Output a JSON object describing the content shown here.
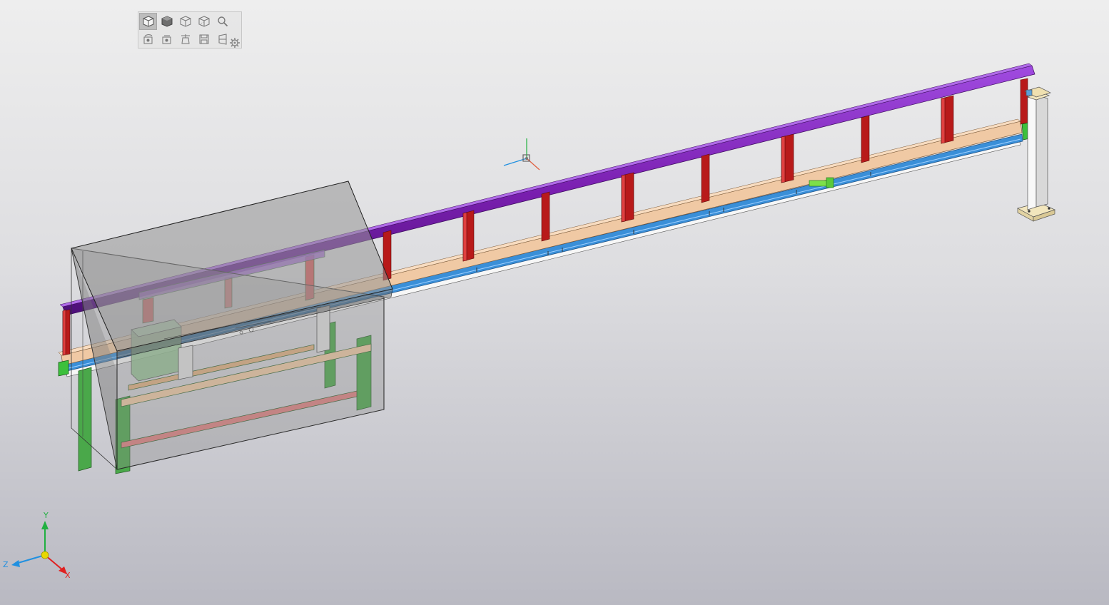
{
  "toolbar": {
    "row1": [
      "view-orientation-icon",
      "shaded-icon",
      "wireframe-icon",
      "hidden-lines-icon",
      "zoom-icon"
    ],
    "row2": [
      "rotate-view-icon",
      "pan-view-icon",
      "section-icon",
      "save-view-icon",
      "perspective-icon"
    ],
    "active": "view-orientation-icon",
    "settings_icon": "gear-icon"
  },
  "axis_triad": {
    "x": "X",
    "y": "Y",
    "z": "Z",
    "colors": {
      "x": "#e02020",
      "y": "#20b040",
      "z": "#2090e0",
      "origin": "#e8d800"
    }
  },
  "model_colors": {
    "top_rail": "#7a1fb0",
    "posts": "#b81a1a",
    "beam": "#f0c9a4",
    "guide_rail": "#3a8fd8",
    "frame": "#4aa84a",
    "housing": "rgba(150,150,150,0.45)",
    "end_stand": "#f4f4f4",
    "end_stand_base": "#f2e6bd"
  }
}
